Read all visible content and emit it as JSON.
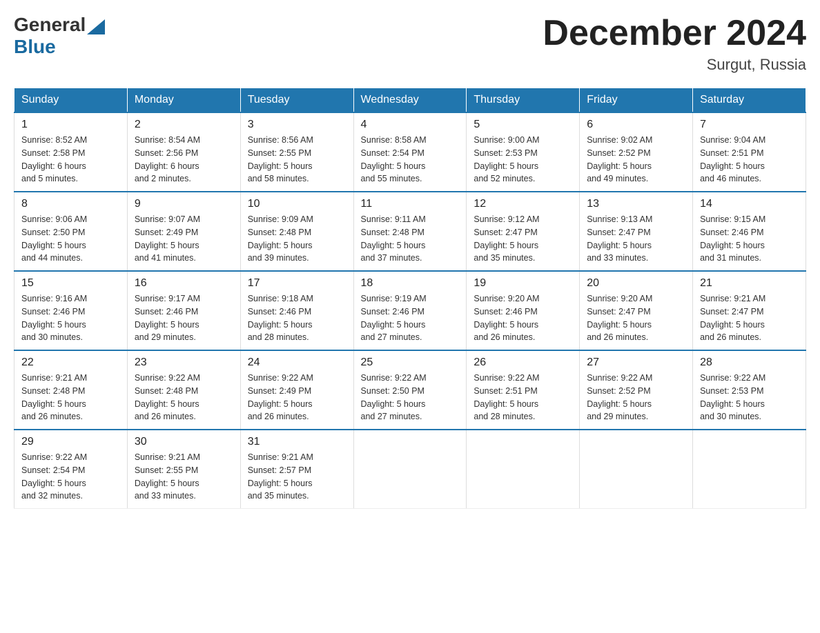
{
  "logo": {
    "text_general": "General",
    "text_blue": "Blue",
    "triangle": "▶"
  },
  "title": "December 2024",
  "subtitle": "Surgut, Russia",
  "days_of_week": [
    "Sunday",
    "Monday",
    "Tuesday",
    "Wednesday",
    "Thursday",
    "Friday",
    "Saturday"
  ],
  "weeks": [
    [
      {
        "day": "1",
        "info": "Sunrise: 8:52 AM\nSunset: 2:58 PM\nDaylight: 6 hours\nand 5 minutes."
      },
      {
        "day": "2",
        "info": "Sunrise: 8:54 AM\nSunset: 2:56 PM\nDaylight: 6 hours\nand 2 minutes."
      },
      {
        "day": "3",
        "info": "Sunrise: 8:56 AM\nSunset: 2:55 PM\nDaylight: 5 hours\nand 58 minutes."
      },
      {
        "day": "4",
        "info": "Sunrise: 8:58 AM\nSunset: 2:54 PM\nDaylight: 5 hours\nand 55 minutes."
      },
      {
        "day": "5",
        "info": "Sunrise: 9:00 AM\nSunset: 2:53 PM\nDaylight: 5 hours\nand 52 minutes."
      },
      {
        "day": "6",
        "info": "Sunrise: 9:02 AM\nSunset: 2:52 PM\nDaylight: 5 hours\nand 49 minutes."
      },
      {
        "day": "7",
        "info": "Sunrise: 9:04 AM\nSunset: 2:51 PM\nDaylight: 5 hours\nand 46 minutes."
      }
    ],
    [
      {
        "day": "8",
        "info": "Sunrise: 9:06 AM\nSunset: 2:50 PM\nDaylight: 5 hours\nand 44 minutes."
      },
      {
        "day": "9",
        "info": "Sunrise: 9:07 AM\nSunset: 2:49 PM\nDaylight: 5 hours\nand 41 minutes."
      },
      {
        "day": "10",
        "info": "Sunrise: 9:09 AM\nSunset: 2:48 PM\nDaylight: 5 hours\nand 39 minutes."
      },
      {
        "day": "11",
        "info": "Sunrise: 9:11 AM\nSunset: 2:48 PM\nDaylight: 5 hours\nand 37 minutes."
      },
      {
        "day": "12",
        "info": "Sunrise: 9:12 AM\nSunset: 2:47 PM\nDaylight: 5 hours\nand 35 minutes."
      },
      {
        "day": "13",
        "info": "Sunrise: 9:13 AM\nSunset: 2:47 PM\nDaylight: 5 hours\nand 33 minutes."
      },
      {
        "day": "14",
        "info": "Sunrise: 9:15 AM\nSunset: 2:46 PM\nDaylight: 5 hours\nand 31 minutes."
      }
    ],
    [
      {
        "day": "15",
        "info": "Sunrise: 9:16 AM\nSunset: 2:46 PM\nDaylight: 5 hours\nand 30 minutes."
      },
      {
        "day": "16",
        "info": "Sunrise: 9:17 AM\nSunset: 2:46 PM\nDaylight: 5 hours\nand 29 minutes."
      },
      {
        "day": "17",
        "info": "Sunrise: 9:18 AM\nSunset: 2:46 PM\nDaylight: 5 hours\nand 28 minutes."
      },
      {
        "day": "18",
        "info": "Sunrise: 9:19 AM\nSunset: 2:46 PM\nDaylight: 5 hours\nand 27 minutes."
      },
      {
        "day": "19",
        "info": "Sunrise: 9:20 AM\nSunset: 2:46 PM\nDaylight: 5 hours\nand 26 minutes."
      },
      {
        "day": "20",
        "info": "Sunrise: 9:20 AM\nSunset: 2:47 PM\nDaylight: 5 hours\nand 26 minutes."
      },
      {
        "day": "21",
        "info": "Sunrise: 9:21 AM\nSunset: 2:47 PM\nDaylight: 5 hours\nand 26 minutes."
      }
    ],
    [
      {
        "day": "22",
        "info": "Sunrise: 9:21 AM\nSunset: 2:48 PM\nDaylight: 5 hours\nand 26 minutes."
      },
      {
        "day": "23",
        "info": "Sunrise: 9:22 AM\nSunset: 2:48 PM\nDaylight: 5 hours\nand 26 minutes."
      },
      {
        "day": "24",
        "info": "Sunrise: 9:22 AM\nSunset: 2:49 PM\nDaylight: 5 hours\nand 26 minutes."
      },
      {
        "day": "25",
        "info": "Sunrise: 9:22 AM\nSunset: 2:50 PM\nDaylight: 5 hours\nand 27 minutes."
      },
      {
        "day": "26",
        "info": "Sunrise: 9:22 AM\nSunset: 2:51 PM\nDaylight: 5 hours\nand 28 minutes."
      },
      {
        "day": "27",
        "info": "Sunrise: 9:22 AM\nSunset: 2:52 PM\nDaylight: 5 hours\nand 29 minutes."
      },
      {
        "day": "28",
        "info": "Sunrise: 9:22 AM\nSunset: 2:53 PM\nDaylight: 5 hours\nand 30 minutes."
      }
    ],
    [
      {
        "day": "29",
        "info": "Sunrise: 9:22 AM\nSunset: 2:54 PM\nDaylight: 5 hours\nand 32 minutes."
      },
      {
        "day": "30",
        "info": "Sunrise: 9:21 AM\nSunset: 2:55 PM\nDaylight: 5 hours\nand 33 minutes."
      },
      {
        "day": "31",
        "info": "Sunrise: 9:21 AM\nSunset: 2:57 PM\nDaylight: 5 hours\nand 35 minutes."
      },
      {
        "day": "",
        "info": ""
      },
      {
        "day": "",
        "info": ""
      },
      {
        "day": "",
        "info": ""
      },
      {
        "day": "",
        "info": ""
      }
    ]
  ]
}
